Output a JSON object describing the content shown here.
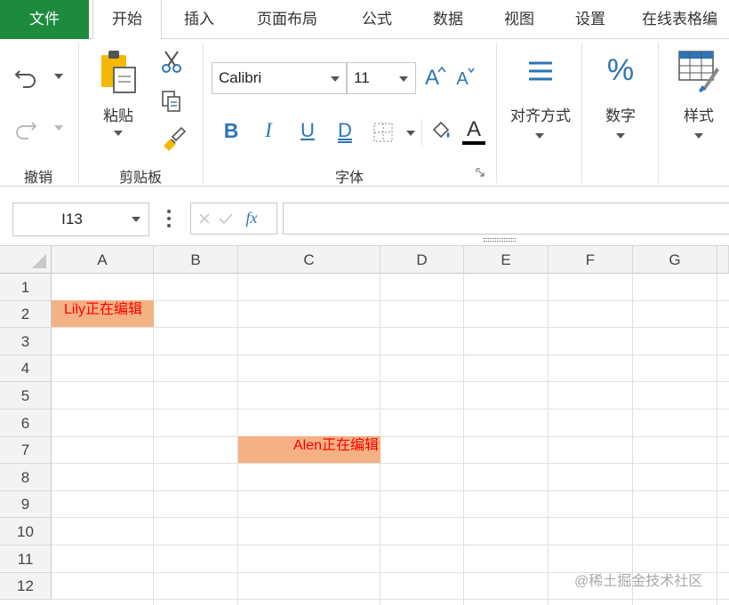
{
  "tabs": {
    "file": "文件",
    "home": "开始",
    "insert": "插入",
    "page_layout": "页面布局",
    "formulas": "公式",
    "data": "数据",
    "view": "视图",
    "settings": "设置",
    "online": "在线表格编"
  },
  "ribbon": {
    "undo_group": "撤销",
    "clipboard_group": "剪贴板",
    "paste_label": "粘贴",
    "font_group": "字体",
    "font_name": "Calibri",
    "font_size": "11",
    "bold": "B",
    "italic": "I",
    "underline": "U",
    "double_underline": "D",
    "font_color_glyph": "A",
    "grow_font": "A",
    "shrink_font": "A",
    "align_label": "对齐方式",
    "number_label": "数字",
    "percent_glyph": "%",
    "style_label": "样式"
  },
  "formula_bar": {
    "name_box": "I13",
    "fx": "fx",
    "formula_value": ""
  },
  "grid": {
    "columns": [
      "A",
      "B",
      "C",
      "D",
      "E",
      "F",
      "G"
    ],
    "rows": [
      "1",
      "2",
      "3",
      "4",
      "5",
      "6",
      "7",
      "8",
      "9",
      "10",
      "11",
      "12"
    ],
    "highlighted_cells": [
      {
        "ref": "A2",
        "text": "Lily正在编辑"
      },
      {
        "ref": "C7",
        "text": "Alen正在编辑"
      }
    ]
  },
  "colors": {
    "file_tab": "#1e8a3e",
    "accent_blue": "#2e75b6",
    "highlight_fill": "#f4b183",
    "highlight_text": "#ff0000"
  },
  "watermark": "@稀土掘金技术社区"
}
